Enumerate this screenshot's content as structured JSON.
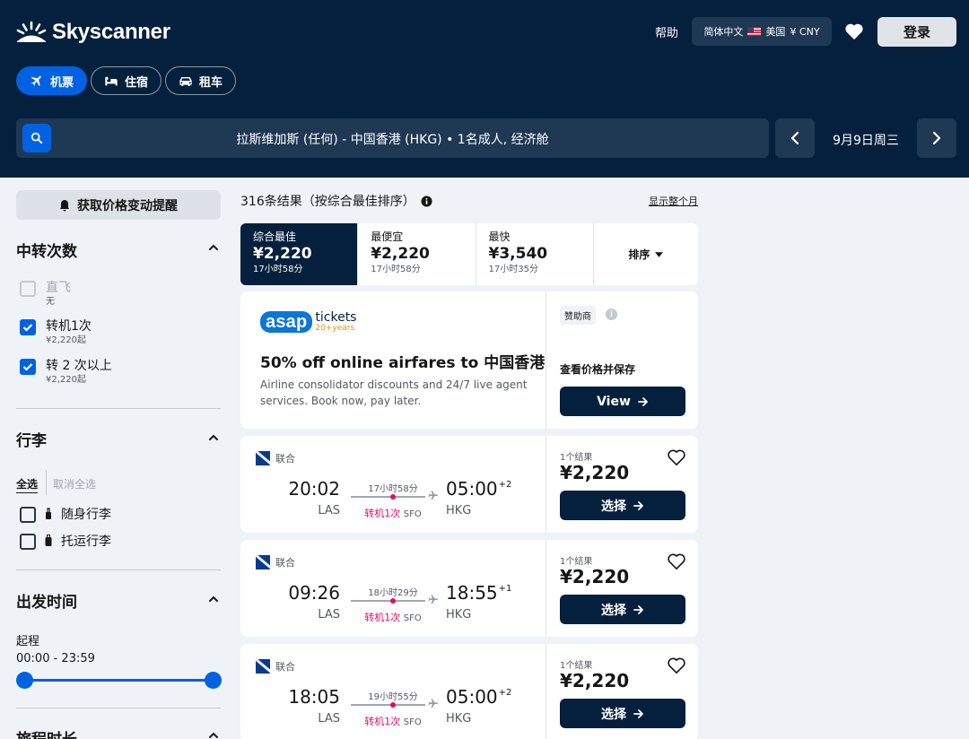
{
  "header": {
    "logo_text": "Skyscanner",
    "help": "帮助",
    "locale": {
      "language": "简体中文",
      "region": "美国",
      "currency": "¥ CNY"
    },
    "login": "登录",
    "tabs": [
      {
        "label": "机票",
        "icon": "plane-icon",
        "active": true
      },
      {
        "label": "住宿",
        "icon": "bed-icon",
        "active": false
      },
      {
        "label": "租车",
        "icon": "car-icon",
        "active": false
      }
    ],
    "search_summary": "拉斯维加斯 (任何) - 中国香港 (HKG)  •  1名成人, 经济舱",
    "date": "9月9日周三"
  },
  "sidebar": {
    "price_alert": "获取价格变动提醒",
    "stops": {
      "title": "中转次数",
      "options": [
        {
          "label": "直飞",
          "sub": "无",
          "checked": false,
          "disabled": true
        },
        {
          "label": "转机1次",
          "sub": "¥2,220起",
          "checked": true,
          "disabled": false
        },
        {
          "label": "转 2 次以上",
          "sub": "¥2,220起",
          "checked": true,
          "disabled": false
        }
      ]
    },
    "baggage": {
      "title": "行李",
      "select_all": "全选",
      "clear_all": "取消全选",
      "options": [
        {
          "label": "随身行李",
          "checked": false
        },
        {
          "label": "托运行李",
          "checked": false
        }
      ]
    },
    "departure": {
      "title": "出发时间",
      "label": "起程",
      "range": "00:00 - 23:59",
      "slider_min": 0,
      "slider_max": 1
    },
    "duration": {
      "title": "旅程时长"
    }
  },
  "results": {
    "count_text": "316条结果（按综合最佳排序）",
    "month_link": "显示整个月",
    "sort_tabs": [
      {
        "label": "综合最佳",
        "price": "¥2,220",
        "time": "17小时58分",
        "active": true
      },
      {
        "label": "最便宜",
        "price": "¥2,220",
        "time": "17小时58分",
        "active": false
      },
      {
        "label": "最快",
        "price": "¥3,540",
        "time": "17小时35分",
        "active": false
      }
    ],
    "sort_menu": "排序",
    "ad": {
      "brand": "asap",
      "brand_suffix": "tickets",
      "brand_years": "20+years",
      "title": "50% off online airfares to 中国香港",
      "description": "Airline consolidator discounts and 24/7 live agent services. Book now, pay later.",
      "sponsor_label": "赞助商",
      "cta_text": "查看价格并保存",
      "button": "View"
    },
    "flights": [
      {
        "airline": "联合",
        "dep_time": "20:02",
        "dep_code": "LAS",
        "duration": "17小时58分",
        "stops": "转机1次",
        "via": "SFO",
        "arr_time": "05:00",
        "arr_offset": "+2",
        "arr_code": "HKG",
        "results": "1个结果",
        "price": "¥2,220",
        "button": "选择"
      },
      {
        "airline": "联合",
        "dep_time": "09:26",
        "dep_code": "LAS",
        "duration": "18小时29分",
        "stops": "转机1次",
        "via": "SFO",
        "arr_time": "18:55",
        "arr_offset": "+1",
        "arr_code": "HKG",
        "results": "1个结果",
        "price": "¥2,220",
        "button": "选择"
      },
      {
        "airline": "联合",
        "dep_time": "18:05",
        "dep_code": "LAS",
        "duration": "19小时55分",
        "stops": "转机1次",
        "via": "SFO",
        "arr_time": "05:00",
        "arr_offset": "+2",
        "arr_code": "HKG",
        "results": "1个结果",
        "price": "¥2,220",
        "button": "选择"
      }
    ]
  },
  "colors": {
    "header_bg": "#05203c",
    "accent_blue": "#0062e3",
    "stop_pink": "#e70866",
    "page_bg": "#eff3f8"
  }
}
